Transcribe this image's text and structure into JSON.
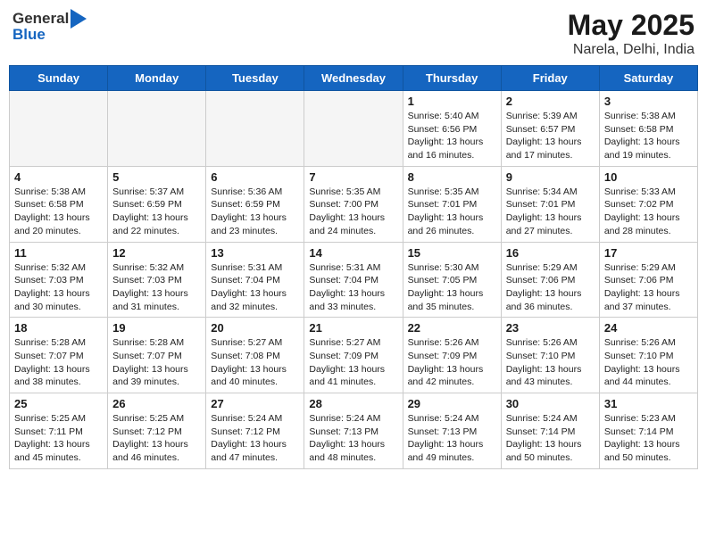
{
  "header": {
    "logo_general": "General",
    "logo_blue": "Blue",
    "title": "May 2025",
    "subtitle": "Narela, Delhi, India"
  },
  "days_of_week": [
    "Sunday",
    "Monday",
    "Tuesday",
    "Wednesday",
    "Thursday",
    "Friday",
    "Saturday"
  ],
  "weeks": [
    {
      "days": [
        {
          "num": "",
          "info": ""
        },
        {
          "num": "",
          "info": ""
        },
        {
          "num": "",
          "info": ""
        },
        {
          "num": "",
          "info": ""
        },
        {
          "num": "1",
          "info": "Sunrise: 5:40 AM\nSunset: 6:56 PM\nDaylight: 13 hours\nand 16 minutes."
        },
        {
          "num": "2",
          "info": "Sunrise: 5:39 AM\nSunset: 6:57 PM\nDaylight: 13 hours\nand 17 minutes."
        },
        {
          "num": "3",
          "info": "Sunrise: 5:38 AM\nSunset: 6:58 PM\nDaylight: 13 hours\nand 19 minutes."
        }
      ]
    },
    {
      "days": [
        {
          "num": "4",
          "info": "Sunrise: 5:38 AM\nSunset: 6:58 PM\nDaylight: 13 hours\nand 20 minutes."
        },
        {
          "num": "5",
          "info": "Sunrise: 5:37 AM\nSunset: 6:59 PM\nDaylight: 13 hours\nand 22 minutes."
        },
        {
          "num": "6",
          "info": "Sunrise: 5:36 AM\nSunset: 6:59 PM\nDaylight: 13 hours\nand 23 minutes."
        },
        {
          "num": "7",
          "info": "Sunrise: 5:35 AM\nSunset: 7:00 PM\nDaylight: 13 hours\nand 24 minutes."
        },
        {
          "num": "8",
          "info": "Sunrise: 5:35 AM\nSunset: 7:01 PM\nDaylight: 13 hours\nand 26 minutes."
        },
        {
          "num": "9",
          "info": "Sunrise: 5:34 AM\nSunset: 7:01 PM\nDaylight: 13 hours\nand 27 minutes."
        },
        {
          "num": "10",
          "info": "Sunrise: 5:33 AM\nSunset: 7:02 PM\nDaylight: 13 hours\nand 28 minutes."
        }
      ]
    },
    {
      "days": [
        {
          "num": "11",
          "info": "Sunrise: 5:32 AM\nSunset: 7:03 PM\nDaylight: 13 hours\nand 30 minutes."
        },
        {
          "num": "12",
          "info": "Sunrise: 5:32 AM\nSunset: 7:03 PM\nDaylight: 13 hours\nand 31 minutes."
        },
        {
          "num": "13",
          "info": "Sunrise: 5:31 AM\nSunset: 7:04 PM\nDaylight: 13 hours\nand 32 minutes."
        },
        {
          "num": "14",
          "info": "Sunrise: 5:31 AM\nSunset: 7:04 PM\nDaylight: 13 hours\nand 33 minutes."
        },
        {
          "num": "15",
          "info": "Sunrise: 5:30 AM\nSunset: 7:05 PM\nDaylight: 13 hours\nand 35 minutes."
        },
        {
          "num": "16",
          "info": "Sunrise: 5:29 AM\nSunset: 7:06 PM\nDaylight: 13 hours\nand 36 minutes."
        },
        {
          "num": "17",
          "info": "Sunrise: 5:29 AM\nSunset: 7:06 PM\nDaylight: 13 hours\nand 37 minutes."
        }
      ]
    },
    {
      "days": [
        {
          "num": "18",
          "info": "Sunrise: 5:28 AM\nSunset: 7:07 PM\nDaylight: 13 hours\nand 38 minutes."
        },
        {
          "num": "19",
          "info": "Sunrise: 5:28 AM\nSunset: 7:07 PM\nDaylight: 13 hours\nand 39 minutes."
        },
        {
          "num": "20",
          "info": "Sunrise: 5:27 AM\nSunset: 7:08 PM\nDaylight: 13 hours\nand 40 minutes."
        },
        {
          "num": "21",
          "info": "Sunrise: 5:27 AM\nSunset: 7:09 PM\nDaylight: 13 hours\nand 41 minutes."
        },
        {
          "num": "22",
          "info": "Sunrise: 5:26 AM\nSunset: 7:09 PM\nDaylight: 13 hours\nand 42 minutes."
        },
        {
          "num": "23",
          "info": "Sunrise: 5:26 AM\nSunset: 7:10 PM\nDaylight: 13 hours\nand 43 minutes."
        },
        {
          "num": "24",
          "info": "Sunrise: 5:26 AM\nSunset: 7:10 PM\nDaylight: 13 hours\nand 44 minutes."
        }
      ]
    },
    {
      "days": [
        {
          "num": "25",
          "info": "Sunrise: 5:25 AM\nSunset: 7:11 PM\nDaylight: 13 hours\nand 45 minutes."
        },
        {
          "num": "26",
          "info": "Sunrise: 5:25 AM\nSunset: 7:12 PM\nDaylight: 13 hours\nand 46 minutes."
        },
        {
          "num": "27",
          "info": "Sunrise: 5:24 AM\nSunset: 7:12 PM\nDaylight: 13 hours\nand 47 minutes."
        },
        {
          "num": "28",
          "info": "Sunrise: 5:24 AM\nSunset: 7:13 PM\nDaylight: 13 hours\nand 48 minutes."
        },
        {
          "num": "29",
          "info": "Sunrise: 5:24 AM\nSunset: 7:13 PM\nDaylight: 13 hours\nand 49 minutes."
        },
        {
          "num": "30",
          "info": "Sunrise: 5:24 AM\nSunset: 7:14 PM\nDaylight: 13 hours\nand 50 minutes."
        },
        {
          "num": "31",
          "info": "Sunrise: 5:23 AM\nSunset: 7:14 PM\nDaylight: 13 hours\nand 50 minutes."
        }
      ]
    }
  ]
}
